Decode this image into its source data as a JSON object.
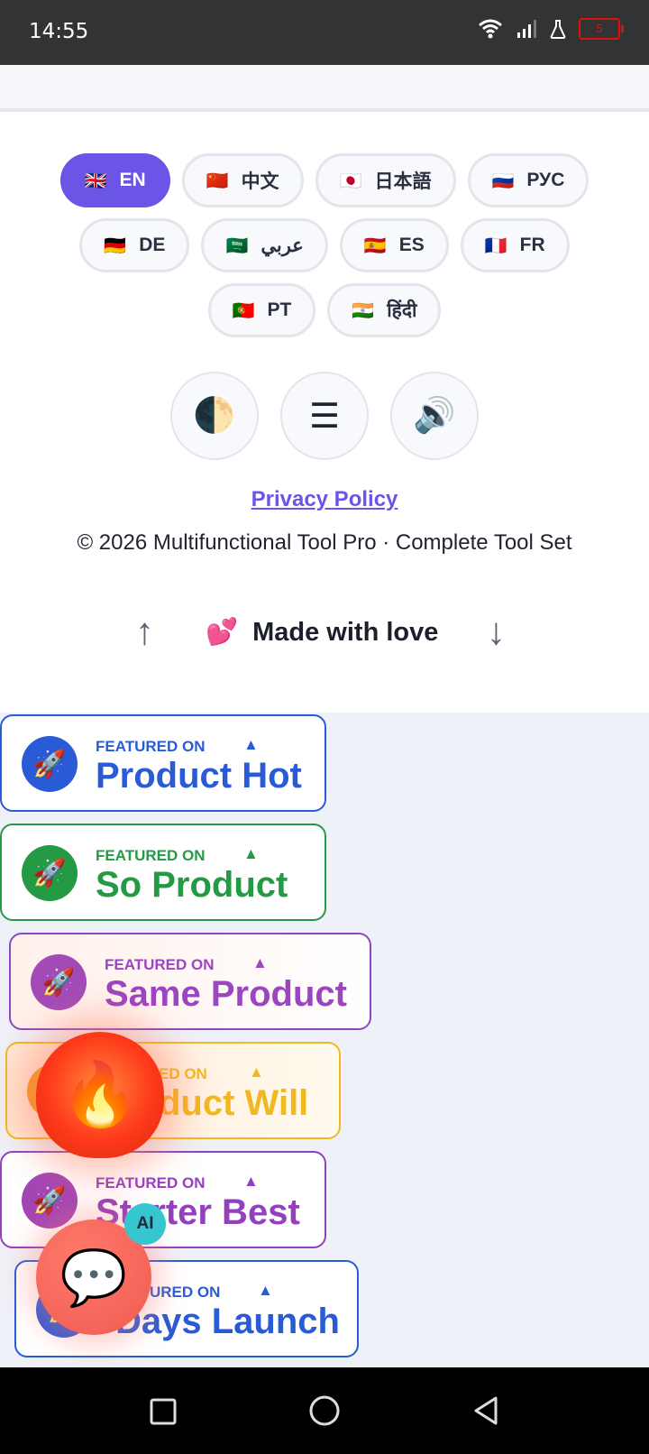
{
  "status_bar": {
    "time": "14:55",
    "battery": "5"
  },
  "languages": [
    {
      "flag": "🇬🇧",
      "label": "EN",
      "active": true
    },
    {
      "flag": "🇨🇳",
      "label": "中文"
    },
    {
      "flag": "🇯🇵",
      "label": "日本語"
    },
    {
      "flag": "🇷🇺",
      "label": "РУС"
    },
    {
      "flag": "🇩🇪",
      "label": "DE"
    },
    {
      "flag": "🇸🇦",
      "label": "عربي"
    },
    {
      "flag": "🇪🇸",
      "label": "ES"
    },
    {
      "flag": "🇫🇷",
      "label": "FR"
    },
    {
      "flag": "🇵🇹",
      "label": "PT"
    },
    {
      "flag": "🇮🇳",
      "label": "हिंदी"
    }
  ],
  "controls": {
    "theme_icon": "🌓",
    "menu_icon": "☰",
    "sound_icon": "🔊"
  },
  "footer": {
    "privacy_label": "Privacy Policy",
    "copyright": "© 2026 Multifunctional Tool Pro · Complete Tool Set",
    "love_heart": "💕",
    "love_text": "Made with love",
    "arrow_up": "↑",
    "arrow_down": "↓"
  },
  "badges": [
    {
      "small": "FEATURED ON",
      "name": "Product Hot",
      "triangle": "▲",
      "color": "#2a5bd7"
    },
    {
      "small": "FEATURED ON",
      "name": "So Product",
      "triangle": "▲",
      "color": "#249a44"
    },
    {
      "small": "FEATURED ON",
      "name": "Same Product",
      "triangle": "▲",
      "color": "#9b45c0"
    },
    {
      "small": "ED ON",
      "name": "duct Will",
      "triangle": "▲",
      "color": "#f2b820"
    },
    {
      "small": "FEATURED ON",
      "name": "Starter Best",
      "triangle": "▲",
      "color": "#9340bf"
    },
    {
      "small": "URED ON",
      "name": "Days Launch",
      "triangle": "▲",
      "color": "#2a5bd7"
    }
  ],
  "floating": {
    "fire_icon": "🔥",
    "chat_icon": "💬",
    "ai_label": "AI"
  }
}
